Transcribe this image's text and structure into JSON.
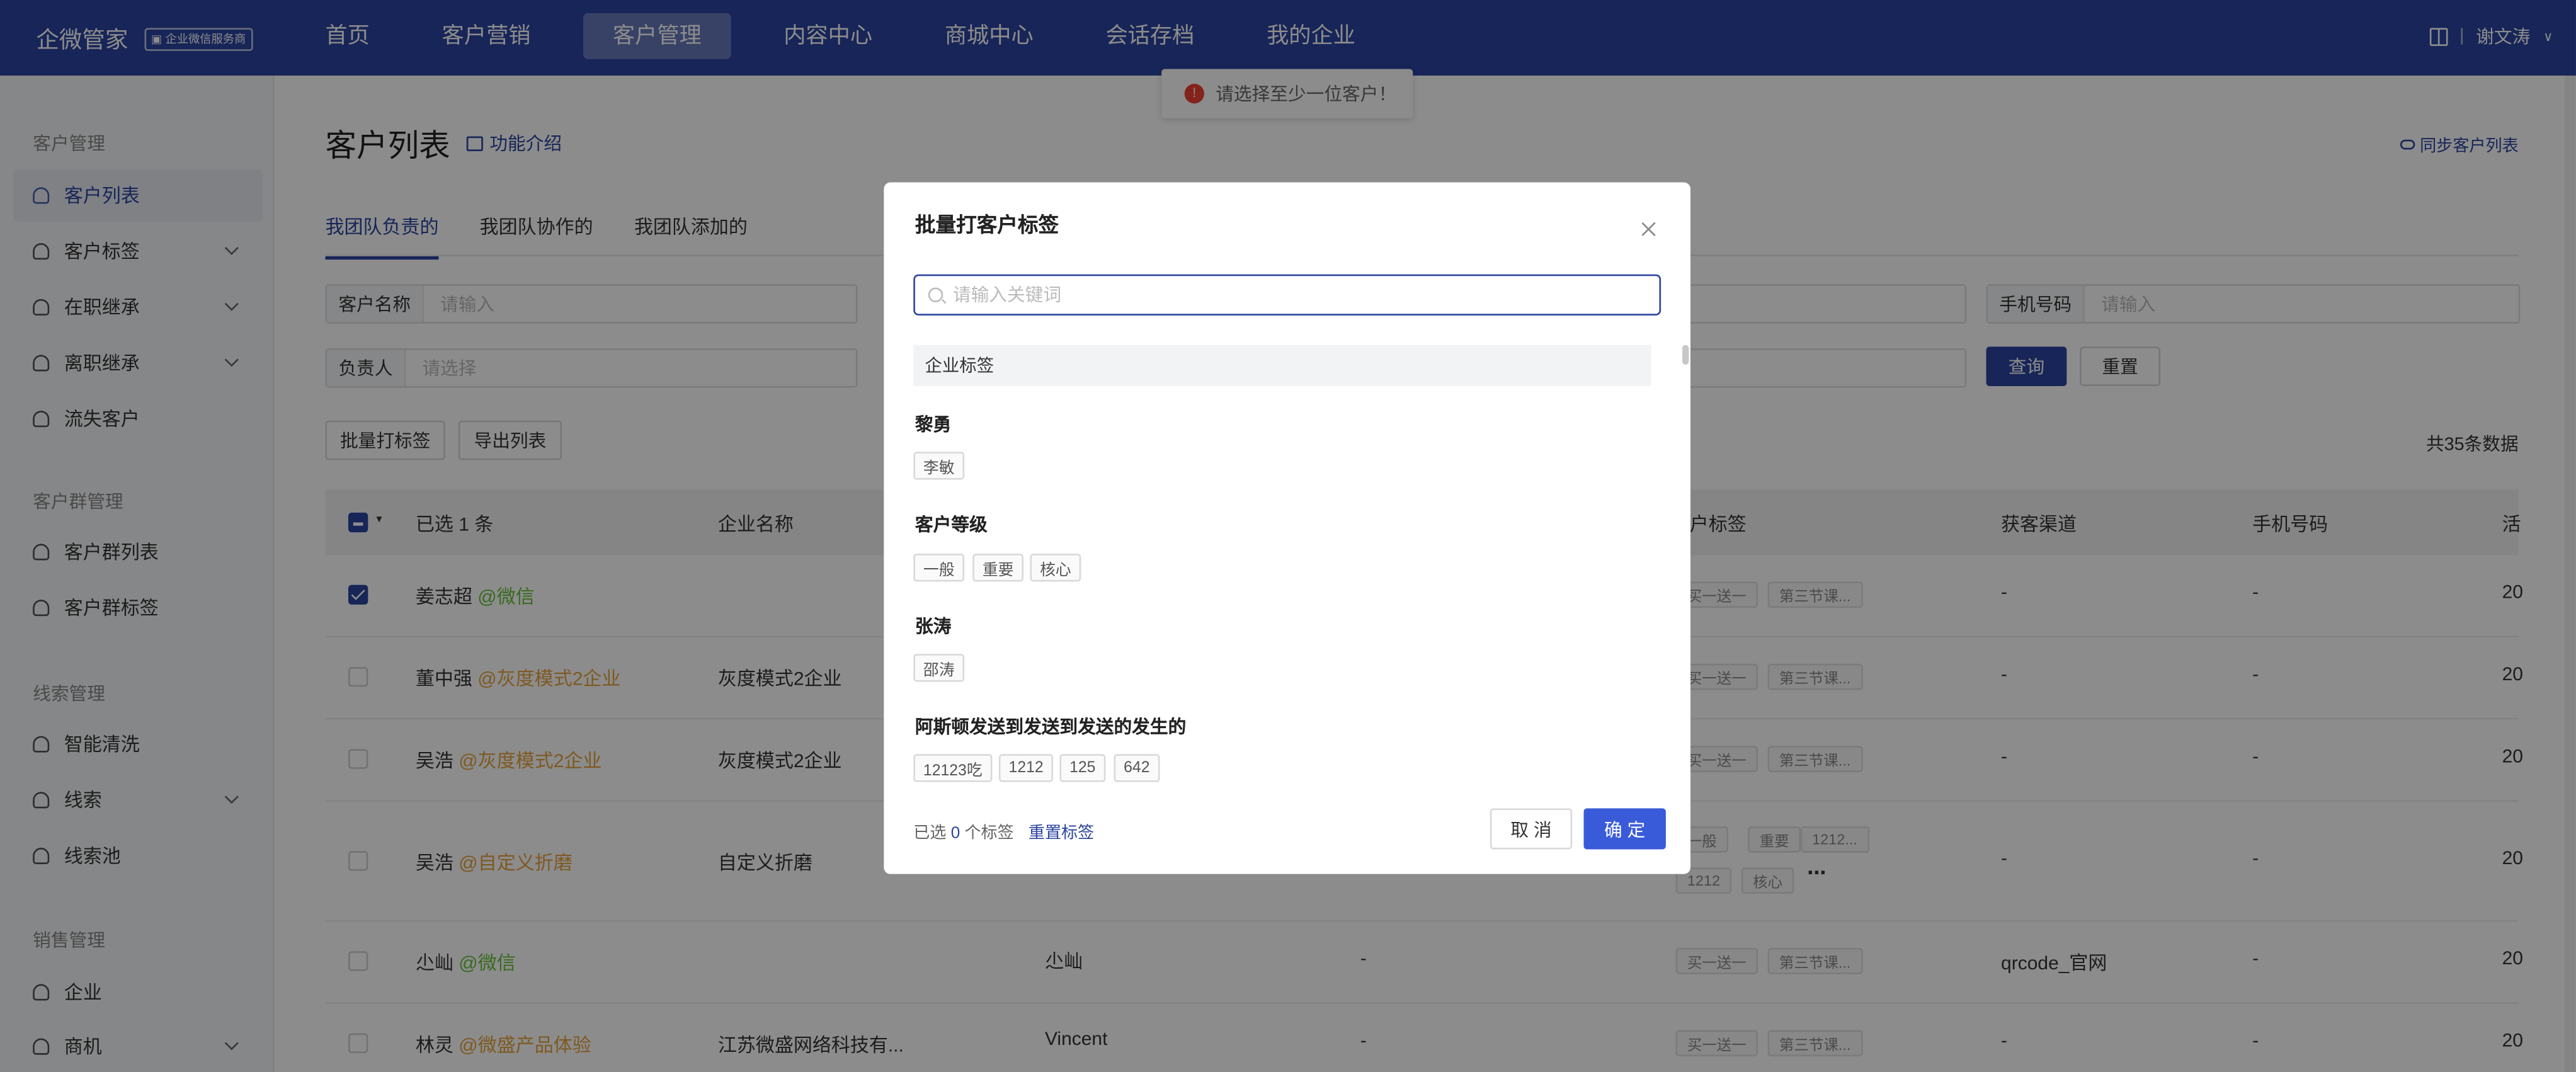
{
  "topbar": {
    "brand": "企微管家",
    "badge": "企业微信服务商",
    "nav": [
      "首页",
      "客户营销",
      "客户管理",
      "内容中心",
      "商城中心",
      "会话存档",
      "我的企业"
    ],
    "active_nav": "客户管理",
    "user": "谢文涛"
  },
  "toast": {
    "message": "请选择至少一位客户！"
  },
  "sidebar": {
    "groups": [
      {
        "title": "客户管理",
        "items": [
          {
            "label": "客户列表",
            "active": true,
            "expandable": false
          },
          {
            "label": "客户标签",
            "expandable": true
          },
          {
            "label": "在职继承",
            "expandable": true
          },
          {
            "label": "离职继承",
            "expandable": true
          },
          {
            "label": "流失客户",
            "expandable": false
          }
        ]
      },
      {
        "title": "客户群管理",
        "items": [
          {
            "label": "客户群列表"
          },
          {
            "label": "客户群标签"
          }
        ]
      },
      {
        "title": "线索管理",
        "items": [
          {
            "label": "智能清洗"
          },
          {
            "label": "线索",
            "expandable": true
          },
          {
            "label": "线索池"
          }
        ]
      },
      {
        "title": "销售管理",
        "items": [
          {
            "label": "企业"
          },
          {
            "label": "商机",
            "expandable": true
          }
        ]
      }
    ]
  },
  "main": {
    "title": "客户列表",
    "intro_link": "功能介绍",
    "sync_link": "同步客户列表",
    "tabs": [
      "我团队负责的",
      "我团队协作的",
      "我团队添加的"
    ],
    "filters": {
      "customer_name": {
        "label": "客户名称",
        "placeholder": "请输入"
      },
      "owner": {
        "label": "负责人",
        "placeholder": "请选择"
      },
      "phone": {
        "label": "手机号码",
        "placeholder": "请输入"
      }
    },
    "buttons": {
      "query": "查询",
      "reset": "重置",
      "batch_tag": "批量打标签",
      "export": "导出列表"
    },
    "total": "共35条数据",
    "table": {
      "selected": "已选 1 条",
      "columns": [
        "企业名称",
        "客户标签",
        "获客渠道",
        "手机号码",
        "活"
      ],
      "rows": [
        {
          "name": "姜志超",
          "suffix": "@微信",
          "suffix_color": "green",
          "company": "",
          "contact": "",
          "col3": "",
          "tags": [
            "买一送一",
            "第三节课..."
          ],
          "channel": "-",
          "phone": "-",
          "date": "20",
          "checked": true
        },
        {
          "name": "董中强",
          "suffix": "@灰度模式2企业",
          "suffix_color": "orange",
          "company": "灰度模式2企业",
          "contact": "",
          "col3": "",
          "tags": [
            "买一送一",
            "第三节课..."
          ],
          "channel": "-",
          "phone": "-",
          "date": "20",
          "checked": false
        },
        {
          "name": "吴浩",
          "suffix": "@灰度模式2企业",
          "suffix_color": "orange",
          "company": "灰度模式2企业",
          "contact": "",
          "col3": "",
          "tags": [
            "买一送一",
            "第三节课..."
          ],
          "channel": "-",
          "phone": "-",
          "date": "20",
          "checked": false
        },
        {
          "name": "吴浩",
          "suffix": "@自定义折磨",
          "suffix_color": "orange",
          "company": "自定义折磨",
          "contact": "",
          "col3": "",
          "tags": [
            "一般",
            "重要",
            "1212...",
            "1212",
            "核心"
          ],
          "channel": "-",
          "phone": "-",
          "date": "20",
          "checked": false
        },
        {
          "name": "尐屾",
          "suffix": "@微信",
          "suffix_color": "green",
          "company": "",
          "contact": "尐屾",
          "col3": "-",
          "tags": [
            "买一送一",
            "第三节课..."
          ],
          "channel": "qrcode_官网",
          "phone": "-",
          "date": "20",
          "checked": false
        },
        {
          "name": "林灵",
          "suffix": "@微盛产品体验",
          "suffix_color": "orange",
          "company": "江苏微盛网络科技有...",
          "contact": "Vincent",
          "col3": "-",
          "tags": [
            "买一送一",
            "第三节课..."
          ],
          "channel": "-",
          "phone": "-",
          "date": "20",
          "checked": false
        }
      ]
    }
  },
  "modal": {
    "title": "批量打客户标签",
    "search_placeholder": "请输入关键词",
    "section": "企业标签",
    "groups": [
      {
        "name": "黎勇",
        "tags": [
          "李敏"
        ]
      },
      {
        "name": "客户等级",
        "tags": [
          "一般",
          "重要",
          "核心"
        ]
      },
      {
        "name": "张涛",
        "tags": [
          "邵涛"
        ]
      },
      {
        "name": "阿斯顿发送到发送到发送的发生的",
        "tags": [
          "12123吃",
          "1212",
          "125",
          "642"
        ]
      }
    ],
    "selected_prefix": "已选",
    "selected_count": "0",
    "selected_suffix": "个标签",
    "reset_tags": "重置标签",
    "cancel": "取 消",
    "confirm": "确 定"
  }
}
